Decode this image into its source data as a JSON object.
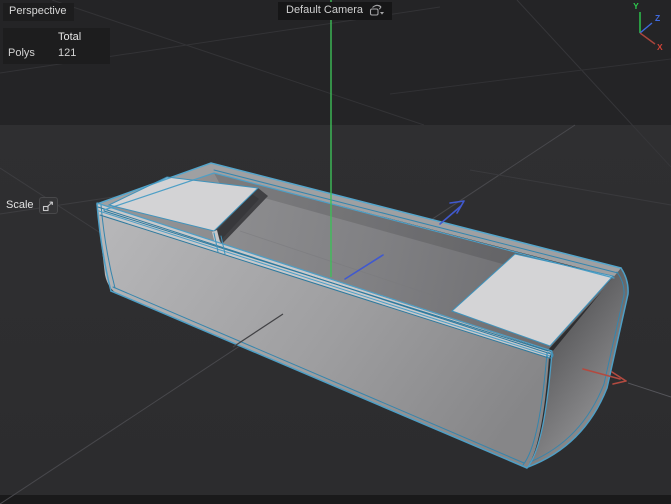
{
  "viewport": {
    "view_menu": {
      "label": "Perspective"
    },
    "camera": {
      "label": "Default Camera",
      "icon": "camera-switch-icon"
    },
    "stats": {
      "header": "Total",
      "rows": [
        {
          "label": "Polys",
          "value": "121"
        }
      ]
    },
    "tool": {
      "label": "Scale",
      "icon": "scale-tool-icon"
    },
    "axis_gizmo": {
      "x": "X",
      "y": "Y",
      "z": "Z"
    },
    "scene": {
      "object": "beveled-hollow-box",
      "selection_wireframe_color": "#4e9fc6",
      "colors": {
        "background_top": "#242426",
        "background_bottom": "#2e2e30",
        "bottom_bar": "#1a1a1b",
        "grid_line": "#3d3d40",
        "axis_x_red": "#b34a40",
        "axis_y_green": "#3dbf58",
        "axis_z_blue": "#4059cf",
        "face_light": "#b4b4b6",
        "face_dark": "#6a6a6c",
        "platform_white": "#d3d3d5",
        "label_bg": "#1d1d1e",
        "label_text": "#d6d6d6"
      }
    }
  }
}
